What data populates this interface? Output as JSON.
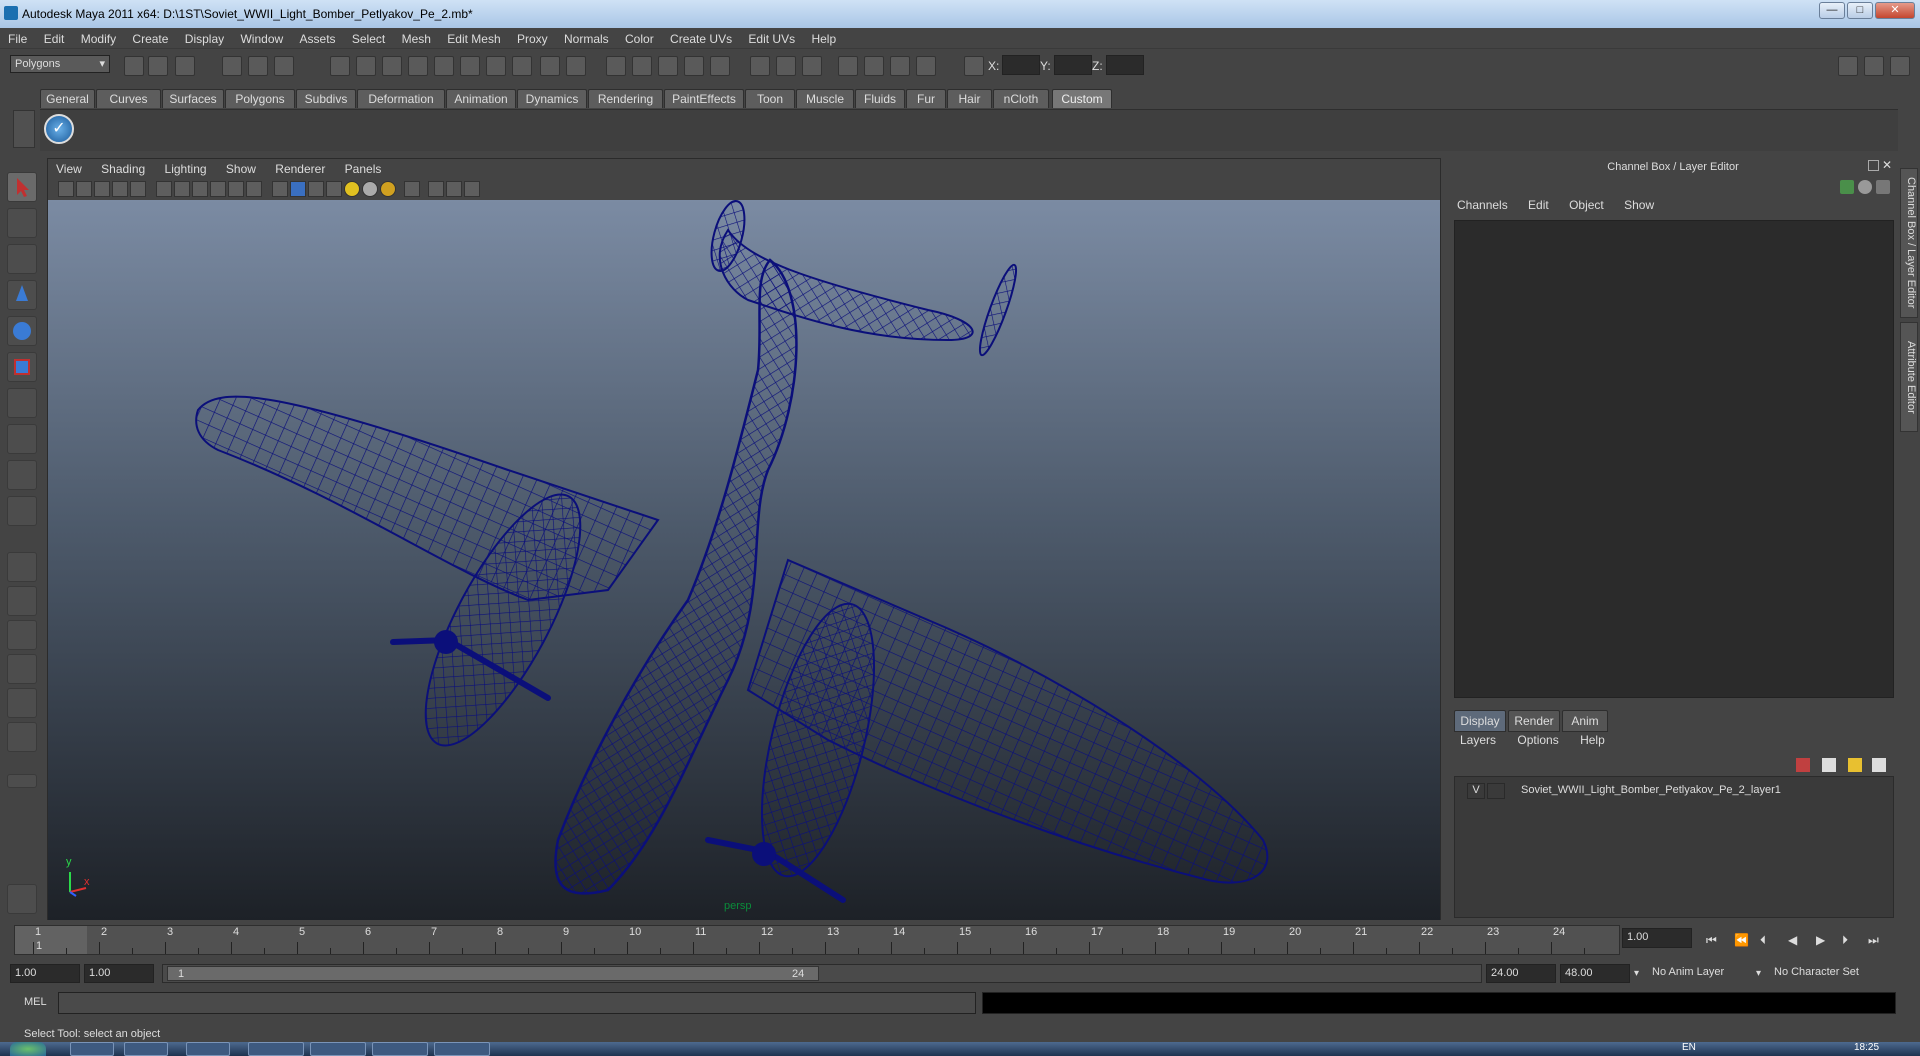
{
  "window": {
    "title": "Autodesk Maya 2011 x64: D:\\1ST\\Soviet_WWII_Light_Bomber_Petlyakov_Pe_2.mb*",
    "minimize": "—",
    "maximize": "□",
    "close": "✕"
  },
  "menubar": [
    "File",
    "Edit",
    "Modify",
    "Create",
    "Display",
    "Window",
    "Assets",
    "Select",
    "Mesh",
    "Edit Mesh",
    "Proxy",
    "Normals",
    "Color",
    "Create UVs",
    "Edit UVs",
    "Help"
  ],
  "statusline": {
    "mode": "Polygons",
    "x_label": "X:",
    "y_label": "Y:",
    "z_label": "Z:"
  },
  "shelf": {
    "tabs": [
      "General",
      "Curves",
      "Surfaces",
      "Polygons",
      "Subdivs",
      "Deformation",
      "Animation",
      "Dynamics",
      "Rendering",
      "PaintEffects",
      "Toon",
      "Muscle",
      "Fluids",
      "Fur",
      "Hair",
      "nCloth",
      "Custom"
    ],
    "active": "Custom"
  },
  "viewport": {
    "menu": [
      "View",
      "Shading",
      "Lighting",
      "Show",
      "Renderer",
      "Panels"
    ],
    "camera_label": "persp",
    "axis_x": "x",
    "axis_y": "y",
    "wire_color": "#0b0f7a"
  },
  "channelbox": {
    "title": "Channel Box / Layer Editor",
    "menu": [
      "Channels",
      "Edit",
      "Object",
      "Show"
    ],
    "layer_tabs": [
      "Display",
      "Render",
      "Anim"
    ],
    "layer_menu": [
      "Layers",
      "Options",
      "Help"
    ],
    "layer": {
      "visibility": "V",
      "name": "Soviet_WWII_Light_Bomber_Petlyakov_Pe_2_layer1"
    }
  },
  "side_tabs": [
    "Channel Box / Layer Editor",
    "Attribute Editor"
  ],
  "timeline": {
    "ticks": [
      "1",
      "2",
      "3",
      "4",
      "5",
      "6",
      "7",
      "8",
      "9",
      "10",
      "11",
      "12",
      "13",
      "14",
      "15",
      "16",
      "17",
      "18",
      "19",
      "20",
      "21",
      "22",
      "23",
      "24"
    ],
    "current_frame": "1",
    "current_time_field": "1.00"
  },
  "range": {
    "start_time": "1.00",
    "playback_start": "1.00",
    "range_start_label": "1",
    "range_end_label": "24",
    "playback_end": "24.00",
    "end_time": "48.00",
    "anim_layer": "No Anim Layer",
    "character_set": "No Character Set"
  },
  "command": {
    "label": "MEL"
  },
  "helpline": "Select Tool: select an object",
  "taskbar": {
    "clock": "18:25",
    "lang": "EN"
  }
}
